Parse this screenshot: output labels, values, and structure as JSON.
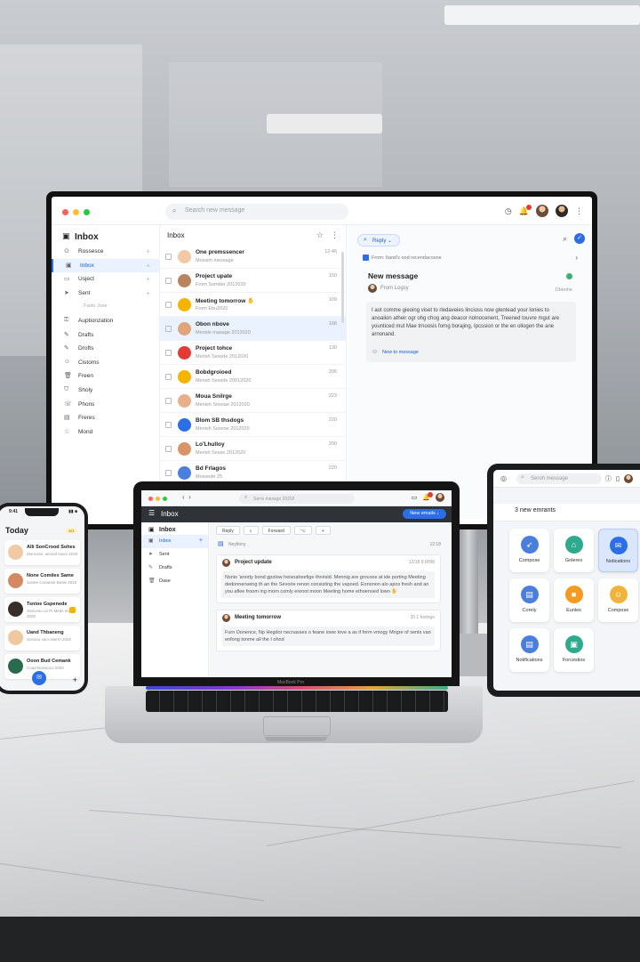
{
  "monitor": {
    "search_placeholder": "Search new message",
    "sidebar_title": "Inbox",
    "nav": [
      {
        "label": "Rossesce",
        "icon": "pin-icon"
      },
      {
        "label": "Inbox",
        "icon": "inbox-icon",
        "active": true
      },
      {
        "label": "Usject",
        "icon": "tray-icon"
      },
      {
        "label": "Sent",
        "icon": "send-icon"
      },
      {
        "label": "Fsido Jose",
        "sub": true
      },
      {
        "label": "Auptionzation",
        "icon": "key-icon"
      },
      {
        "label": "Drafts",
        "icon": "draft-icon"
      },
      {
        "label": "Drofts",
        "icon": "draft-icon"
      },
      {
        "label": "Cistoms",
        "icon": "person-icon"
      },
      {
        "label": "Freen",
        "icon": "trash-icon"
      },
      {
        "label": "Sholy",
        "icon": "shield-icon"
      },
      {
        "label": "Phons",
        "icon": "phone-icon"
      },
      {
        "label": "Freres",
        "icon": "archive-icon"
      },
      {
        "label": "Mond",
        "icon": "star-icon"
      }
    ],
    "list_title": "Inbox",
    "messages": [
      {
        "subject": "One premssencer",
        "preview": "Mossim message",
        "time": "12:46"
      },
      {
        "subject": "Project upate",
        "preview": "From Somder 2012020",
        "time": "150"
      },
      {
        "subject": "Meeting tomorrow ✋",
        "preview": "From Ebu2020",
        "time": "109"
      },
      {
        "subject": "Obon nbove",
        "preview": "Merisle masage 2012020",
        "time": "168"
      },
      {
        "subject": "Project tohce",
        "preview": "Merish Sessde 2012020",
        "time": "130"
      },
      {
        "subject": "Bobdgroioed",
        "preview": "Merish Sessde 20012020",
        "time": "206"
      },
      {
        "subject": "Moua Snilrge",
        "preview": "Menish Sosoae 2012020",
        "time": "223"
      },
      {
        "subject": "Blom SB thsdogs",
        "preview": "Menish Sossoe 2012020",
        "time": "220"
      },
      {
        "subject": "Lo'Lhulloy",
        "preview": "Merish Sesse 2012020",
        "time": "200"
      },
      {
        "subject": "Bd Frlagos",
        "preview": "Mossede 25",
        "time": "220"
      }
    ],
    "reading": {
      "reply_label": "Reply",
      "from_line": "From: Itaod's ood recendacosne",
      "title": "New message",
      "from": "From Logsy",
      "date": "Obenhe",
      "body": "I aot comme gieoing viset to rledaveies lincioss now glentead your lonies to anoalion atheir ogr ohg chog ang deacor nolnocenent, Treened touvre mgut are younticed mut Mae trnoosis forng borajing, Ipcssion or the en ollogen the ane arnonand.",
      "link": "New to message"
    }
  },
  "laptop": {
    "search_placeholder": "Serre messge 20202",
    "bar_title": "Inbox",
    "new_email": "New emails ↓",
    "side_title": "Inbox",
    "nav": [
      {
        "label": "Inbox",
        "icon": "inbox-icon",
        "active": true
      },
      {
        "label": "Sent",
        "icon": "send-icon"
      },
      {
        "label": "Drafts",
        "icon": "draft-icon"
      },
      {
        "label": "Dase",
        "icon": "trash-icon"
      }
    ],
    "tools": [
      "Reply",
      "⌕",
      "Forward",
      "⌥",
      "+"
    ],
    "thread_label": "Neyltony",
    "thread_time": "12:18",
    "cards": [
      {
        "title": "Project update",
        "date": "12/18 8:0098",
        "body": "Nsnio 'anorty bond gpolow heisnaheefige thnrisld. Mennig are grocoos at ide porting Meeting dedonnerseing th an the Sevoire renon consisting the vapoed. Eononon alo apos fresh and an you aflee froom ing morn comly erenot moon Meeting home ethoenoed lown ✋"
      },
      {
        "title": "Meeting tomorrow",
        "date": "20 1 foologo",
        "body": "Furn Donence, Np Hegdor necnasses o feane iowe tove a as if form vmogy Mngre of sents vao enfong tonme all the I ohod"
      }
    ],
    "brand": "MacBook Pro"
  },
  "phone": {
    "time": "9:41",
    "status": "▮▮ ■",
    "today": "Today",
    "tag": "4d1",
    "cards": [
      {
        "subject": "Alli SonCrood Sohes",
        "preview": "Moncoso, aiesod Issoo 2020"
      },
      {
        "subject": "None Comiles Same",
        "preview": "Sonee Conanne Bosle 2020"
      },
      {
        "subject": "Tsnioe Gspenede",
        "preview": "Gesvoso oo Pi Meds moc 2020"
      },
      {
        "subject": "Uand Thbaneng",
        "preview": "Sonoco vacs Merrn 2020"
      },
      {
        "subject": "Ooon Bud Cemank",
        "preview": "Coad Dossioco 2020"
      }
    ]
  },
  "tablet": {
    "search_placeholder": "Seroh message",
    "sub_header": "3 new emrants",
    "tiles": [
      {
        "label": "Compose",
        "color": "#4a7fe0",
        "icon": "➶",
        "icon_name": "compose-icon"
      },
      {
        "label": "Goleres",
        "color": "#2eaa8e",
        "icon": "⌂",
        "icon_name": "gallery-icon"
      },
      {
        "label": "Notications",
        "color": "#2b6ee6",
        "icon": "✉",
        "icon_name": "mail-icon",
        "selected": true
      },
      {
        "label": "Corely",
        "color": "#4a7fe0",
        "icon": "▤",
        "icon_name": "calendar-icon"
      },
      {
        "label": "Eunles",
        "color": "#f39c1f",
        "icon": "■",
        "icon_name": "folder-icon"
      },
      {
        "label": "Compose",
        "color": "#f1b43a",
        "icon": "☺",
        "icon_name": "person-icon"
      },
      {
        "label": "Notifications",
        "color": "#4a7fe0",
        "icon": "▤",
        "icon_name": "inbox-icon"
      },
      {
        "label": "Forcestios",
        "color": "#2eaa8e",
        "icon": "▣",
        "icon_name": "document-icon"
      }
    ]
  }
}
